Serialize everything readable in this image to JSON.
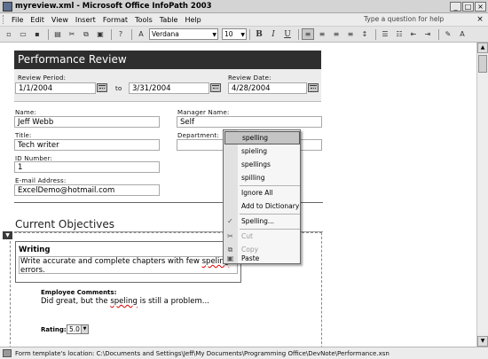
{
  "window": {
    "title": "myreview.xml - Microsoft Office InfoPath 2003",
    "minimize": "_",
    "maximize": "□",
    "close": "×"
  },
  "menubar": {
    "items": [
      "File",
      "Edit",
      "View",
      "Insert",
      "Format",
      "Tools",
      "Table",
      "Help"
    ],
    "help_placeholder": "Type a question for help",
    "close": "×"
  },
  "toolbar": {
    "font_name": "Verdana",
    "font_size": "10",
    "bold": "B",
    "italic": "I",
    "underline": "U"
  },
  "form": {
    "header": "Performance Review",
    "review_period_label": "Review Period:",
    "period_start": "1/1/2004",
    "to_label": "to",
    "period_end": "3/31/2004",
    "review_date_label": "Review Date:",
    "review_date": "4/28/2004",
    "name_label": "Name:",
    "name_value": "Jeff Webb",
    "manager_label": "Manager Name:",
    "manager_value": "Self",
    "title_label": "Title:",
    "title_value": "Tech writer",
    "department_label": "Department:",
    "department_value": "",
    "id_label": "ID Number:",
    "id_value": "1",
    "email_label": "E-mail Address:",
    "email_value": "ExcelDemo@hotmail.com",
    "objectives_title": "Current Objectives",
    "objective": {
      "title": "Writing",
      "text_before": "Write accurate and complete chapters with few ",
      "text_misspelled": "speling",
      "text_after": "errors.",
      "employee_comments_label": "Employee Comments:",
      "comment_before": "Did great, but the ",
      "comment_misspelled": "speling",
      "comment_after": " is still a problem...",
      "rating_label": "Rating:",
      "rating_value": "5.0"
    }
  },
  "context_menu": {
    "suggestions": [
      "spelling",
      "spieling",
      "spellings",
      "spilling"
    ],
    "ignore_all": "Ignore All",
    "add_to_dictionary": "Add to Dictionary",
    "spelling": "Spelling...",
    "cut": "Cut",
    "copy": "Copy",
    "paste": "Paste"
  },
  "statusbar": {
    "text": "Form template's location: C:\\Documents and Settings\\Jeff\\My Documents\\Programming Office\\DevNote\\Performance.xsn"
  }
}
